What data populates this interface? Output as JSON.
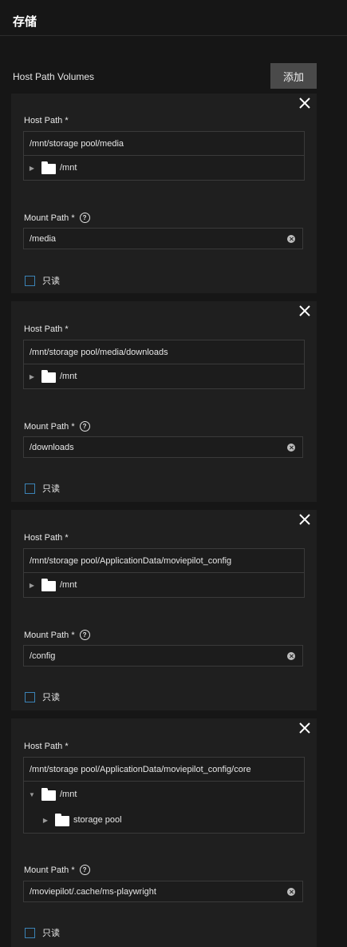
{
  "section": {
    "title": "存储"
  },
  "host_path_volumes": {
    "label": "Host Path Volumes",
    "add_label": "添加"
  },
  "volumes": [
    {
      "host_path_label": "Host Path *",
      "host_path_value": "/mnt/storage pool/media",
      "tree": [
        {
          "label": "/mnt",
          "arrow": "▶"
        }
      ],
      "mount_path_label": "Mount Path *",
      "mount_path_value": "/media",
      "readonly_label": "只读"
    },
    {
      "host_path_label": "Host Path *",
      "host_path_value": "/mnt/storage pool/media/downloads",
      "tree": [
        {
          "label": "/mnt",
          "arrow": "▶"
        }
      ],
      "mount_path_label": "Mount Path *",
      "mount_path_value": "/downloads",
      "readonly_label": "只读"
    },
    {
      "host_path_label": "Host Path *",
      "host_path_value": "/mnt/storage pool/ApplicationData/moviepilot_config",
      "tree": [
        {
          "label": "/mnt",
          "arrow": "▶"
        }
      ],
      "mount_path_label": "Mount Path *",
      "mount_path_value": "/config",
      "readonly_label": "只读"
    },
    {
      "host_path_label": "Host Path *",
      "host_path_value": "/mnt/storage pool/ApplicationData/moviepilot_config/core",
      "tree": [
        {
          "label": "/mnt",
          "arrow": "▼"
        },
        {
          "label": "storage pool",
          "arrow": "▶"
        }
      ],
      "mount_path_label": "Mount Path *",
      "mount_path_value": "/moviepilot/.cache/ms-playwright",
      "readonly_label": "只读"
    }
  ],
  "help_icon": "?",
  "icons": {
    "close": "close-icon",
    "folder": "folder-icon",
    "help": "help-icon",
    "clear": "clear-icon"
  },
  "colors": {
    "background": "#161616",
    "card": "#1f1f1f",
    "add_button": "#4a4a4a",
    "checkbox_border": "#3b83b6"
  }
}
